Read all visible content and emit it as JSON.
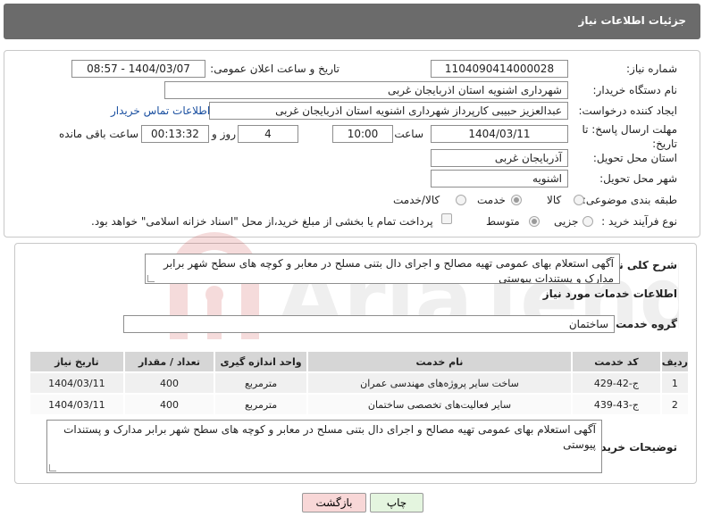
{
  "header": {
    "title": "جزئیات اطلاعات نیاز"
  },
  "form": {
    "need_number_label": "شماره نیاز:",
    "need_number": "1104090414000028",
    "announce_label": "تاریخ و ساعت اعلان عمومی:",
    "announce_value": "1404/03/07 - 08:57",
    "buyer_org_label": "نام دستگاه خریدار:",
    "buyer_org": "شهرداری اشنویه استان اذربایجان غربی",
    "creator_label": "ایجاد کننده درخواست:",
    "creator": "عبدالعزیز حبیبی کارپرداز شهرداری اشنویه استان اذربایجان غربی",
    "contact_link": "اطلاعات تماس خریدار",
    "deadline_label": "مهلت ارسال پاسخ: تا تاریخ:",
    "deadline_date": "1404/03/11",
    "time_label": "ساعت",
    "deadline_time": "10:00",
    "days_value": "4",
    "days_label": "روز و",
    "remaining_time": "00:13:32",
    "remaining_label": "ساعت باقی مانده",
    "province_label": "استان محل تحویل:",
    "province": "آذربایجان غربی",
    "city_label": "شهر محل تحویل:",
    "city": "اشنویه",
    "category_label": "طبقه بندی موضوعی:",
    "category_options": [
      "کالا",
      "خدمت",
      "کالا/خدمت"
    ],
    "process_label": "نوع فرآیند خرید :",
    "process_options": [
      "جزیی",
      "متوسط"
    ],
    "payment_note": "پرداخت تمام یا بخشی از مبلغ خرید،از محل \"اسناد خزانه اسلامی\" خواهد بود."
  },
  "details": {
    "summary_label": "شرح کلی نیاز:",
    "summary_text": "آگهی استعلام بهای عمومی تهیه مصالح و اجرای دال بتنی مسلح در معابر و کوچه های سطح شهر برابر مدارک و پستندات پیوستی",
    "services_title": "اطلاعات خدمات مورد نیاز",
    "service_group_label": "گروه خدمت:",
    "service_group": "ساختمان",
    "table": {
      "headers": [
        "ردیف",
        "کد خدمت",
        "نام خدمت",
        "واحد اندازه گیری",
        "تعداد / مقدار",
        "تاریخ نیاز"
      ],
      "rows": [
        [
          "1",
          "ج-42-429",
          "ساخت سایر پروژه‌های مهندسی عمران",
          "مترمربع",
          "400",
          "1404/03/11"
        ],
        [
          "2",
          "ج-43-439",
          "سایر فعالیت‌های تخصصی ساختمان",
          "مترمربع",
          "400",
          "1404/03/11"
        ]
      ]
    },
    "buyer_notes_label": "توضیحات خریدار:",
    "buyer_notes": "آگهی استعلام بهای عمومی تهیه مصالح و اجرای دال بتنی مسلح در معابر و کوچه های سطح شهر برابر مدارک و پستندات پیوستی"
  },
  "buttons": {
    "print": "چاپ",
    "back": "بازگشت"
  },
  "watermark": {
    "text": "AriaTender.net"
  },
  "colors": {
    "header_bg": "#6b6b6b",
    "back_button_bg": "#f8d7d7",
    "print_button_bg": "#e4f5df",
    "link": "#1a4fa0"
  }
}
